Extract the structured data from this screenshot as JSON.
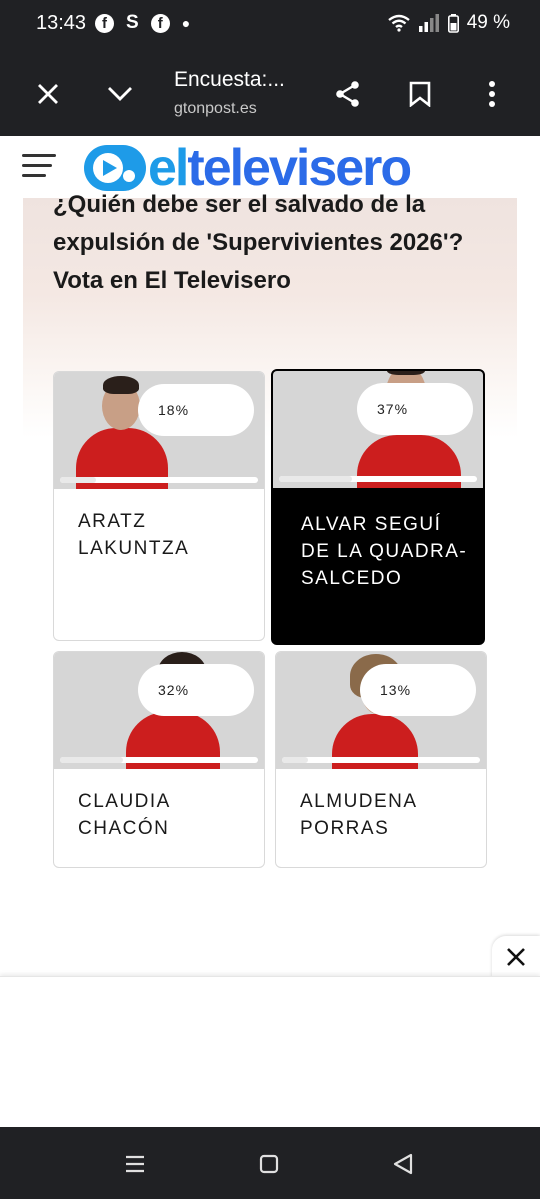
{
  "status": {
    "time": "13:43",
    "battery": "49 %"
  },
  "browser": {
    "title": "Encuesta:...",
    "url": "gtonpost.es"
  },
  "site": {
    "logo_prefix": "el",
    "logo_name": "televisero"
  },
  "article": {
    "headline": "¿Quién debe ser el salvado de la expulsión de 'Supervivientes 2026'? Vota en El Televisero"
  },
  "poll": {
    "options": [
      {
        "name": "ARATZ LAKUNTZA",
        "percent_label": "18%",
        "percent": 18,
        "selected": false
      },
      {
        "name": "ALVAR SEGUÍ DE LA QUADRA-SALCEDO",
        "percent_label": "37%",
        "percent": 37,
        "selected": true
      },
      {
        "name": "CLAUDIA CHACÓN",
        "percent_label": "32%",
        "percent": 32,
        "selected": false
      },
      {
        "name": "ALMUDENA PORRAS",
        "percent_label": "13%",
        "percent": 13,
        "selected": false
      }
    ]
  },
  "colors": {
    "accent": "#1e9be8",
    "shirt": "#cc1e1e",
    "selected_card": "#000000"
  }
}
